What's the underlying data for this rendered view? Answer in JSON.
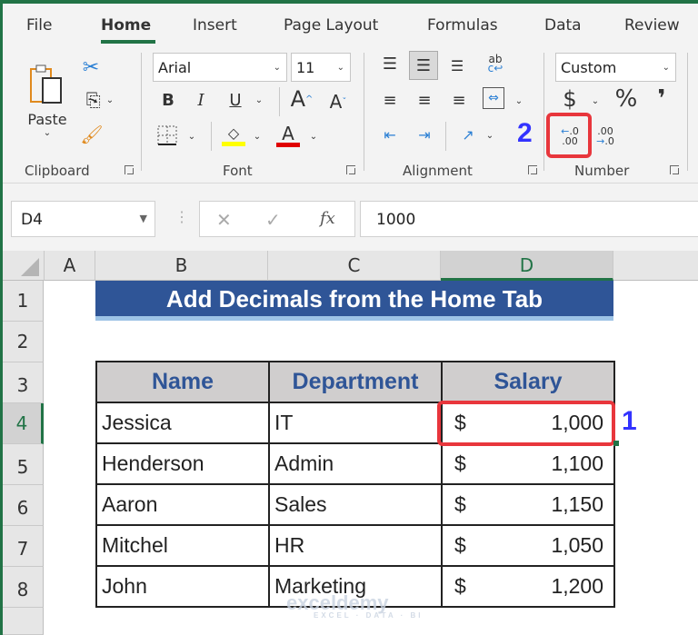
{
  "tabs": [
    {
      "label": "File",
      "active": false
    },
    {
      "label": "Home",
      "active": true
    },
    {
      "label": "Insert",
      "active": false
    },
    {
      "label": "Page Layout",
      "active": false
    },
    {
      "label": "Formulas",
      "active": false
    },
    {
      "label": "Data",
      "active": false
    },
    {
      "label": "Review",
      "active": false
    }
  ],
  "ribbon": {
    "clipboard": {
      "label": "Clipboard",
      "paste_label": "Paste"
    },
    "font": {
      "label": "Font",
      "font_name": "Arial",
      "font_size": "11",
      "bold": "B",
      "italic": "I",
      "underline": "U",
      "grow": "A",
      "shrink": "A",
      "font_color_glyph": "A",
      "highlight_color": "#ffff00",
      "font_color": "#e00000"
    },
    "alignment": {
      "label": "Alignment",
      "wrap_glyph": "ab"
    },
    "number": {
      "label": "Number",
      "format": "Custom",
      "currency": "$",
      "percent": "%",
      "comma": "❜",
      "increase_decimal": "←.0 .00",
      "decrease_decimal": ".00 →.0"
    }
  },
  "formula_bar": {
    "name_box": "D4",
    "cancel": "✕",
    "enter": "✓",
    "fx": "fx",
    "value": "1000"
  },
  "columns": [
    "A",
    "B",
    "C",
    "D"
  ],
  "rows": [
    "1",
    "2",
    "3",
    "4",
    "5",
    "6",
    "7",
    "8"
  ],
  "sheet": {
    "title": "Add Decimals from the Home Tab",
    "headers": [
      "Name",
      "Department",
      "Salary"
    ],
    "records": [
      {
        "name": "Jessica",
        "dept": "IT",
        "currency": "$",
        "salary": "1,000"
      },
      {
        "name": "Henderson",
        "dept": "Admin",
        "currency": "$",
        "salary": "1,100"
      },
      {
        "name": "Aaron",
        "dept": "Sales",
        "currency": "$",
        "salary": "1,150"
      },
      {
        "name": "Mitchel",
        "dept": "HR",
        "currency": "$",
        "salary": "1,050"
      },
      {
        "name": "John",
        "dept": "Marketing",
        "currency": "$",
        "salary": "1,200"
      }
    ]
  },
  "callouts": {
    "step1": "1",
    "step2": "2"
  },
  "watermark": {
    "brand": "exceldemy",
    "tagline": "EXCEL · DATA · BI"
  },
  "colors": {
    "accent": "#217346",
    "title_fill": "#2f5597",
    "header_fill": "#d0cece",
    "highlight": "#e8363c",
    "callout": "#3333ff"
  }
}
